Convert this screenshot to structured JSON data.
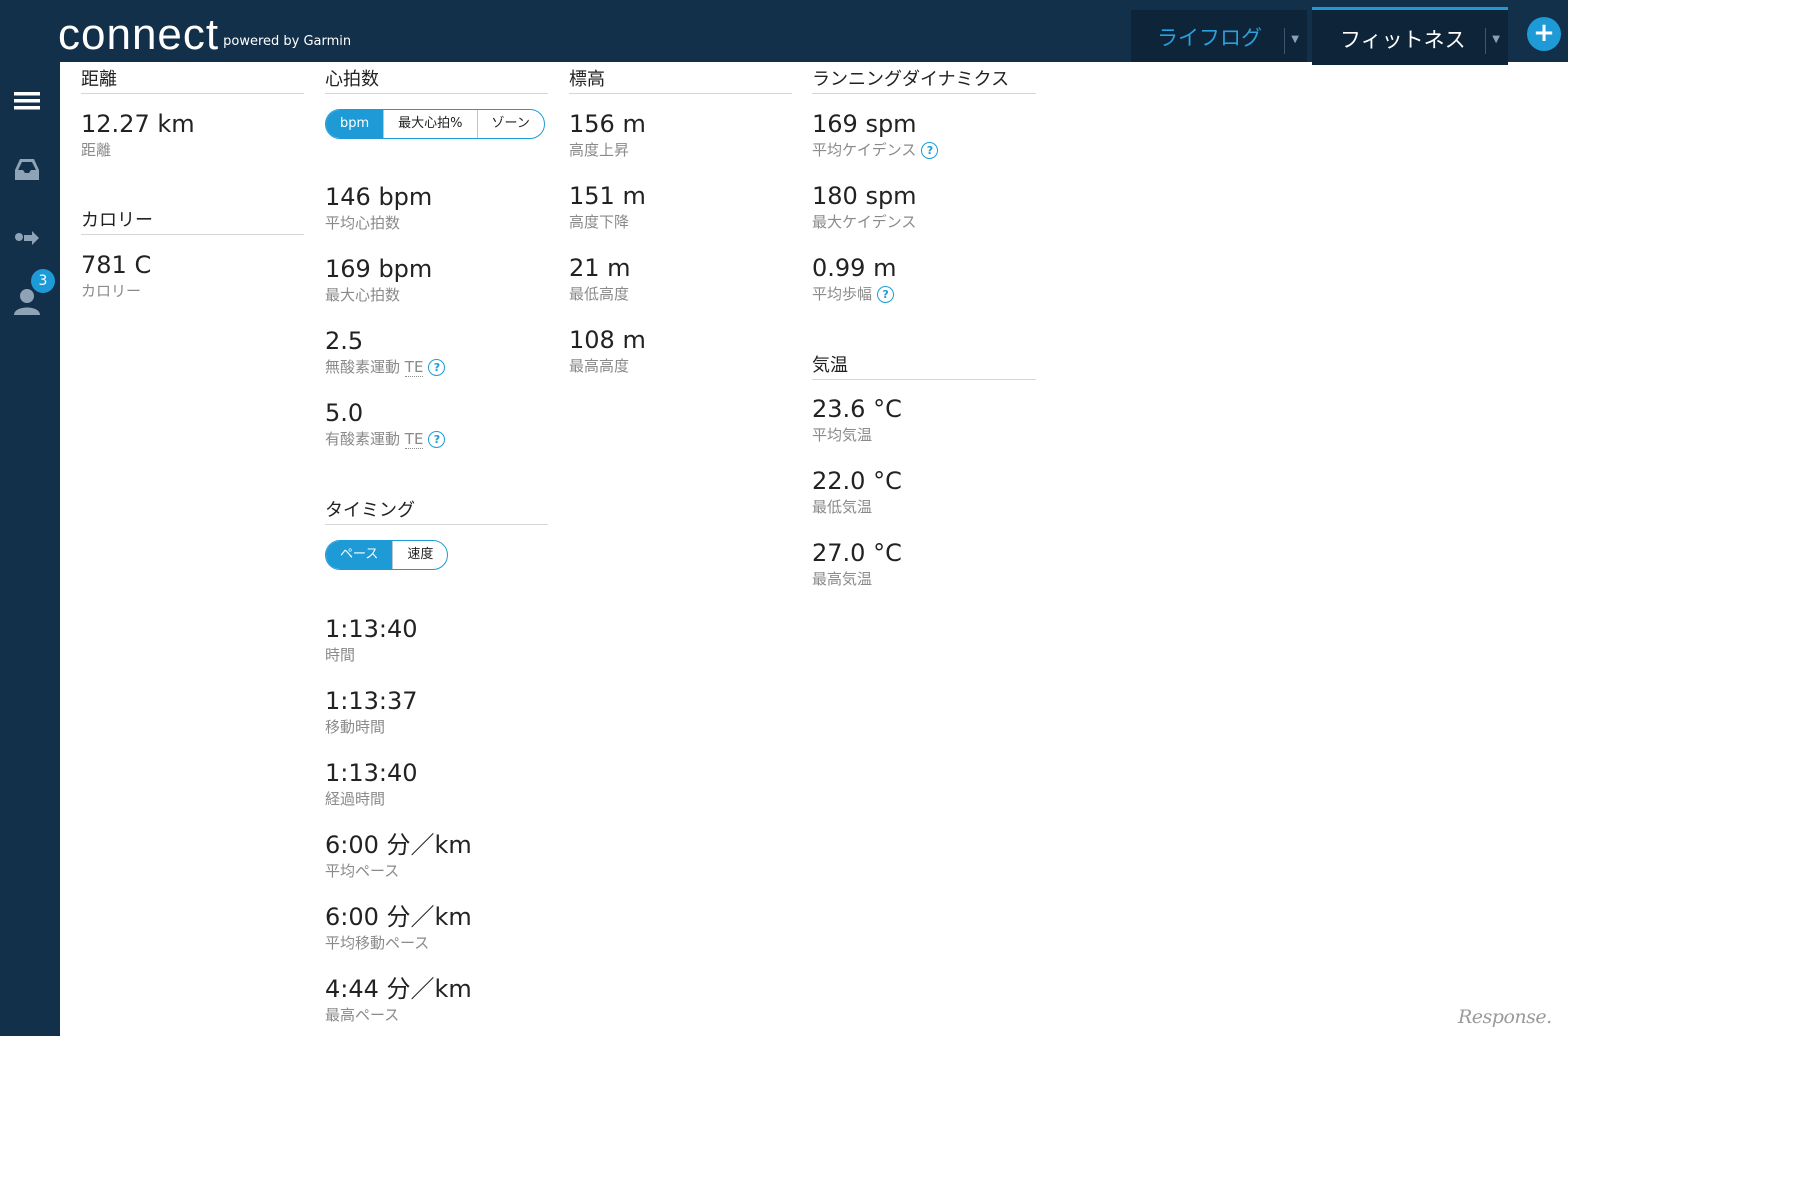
{
  "header": {
    "logo_text": "connect",
    "logo_sub": "powered by Garmin",
    "tabs": [
      {
        "label": "ライフログ",
        "active": false
      },
      {
        "label": "フィットネス",
        "active": true
      }
    ],
    "plus_label": "+"
  },
  "sidebar": {
    "items": [
      {
        "icon": "menu-icon"
      },
      {
        "icon": "inbox-icon"
      },
      {
        "icon": "connections-icon",
        "badge": "3"
      },
      {
        "icon": "profile-icon"
      }
    ]
  },
  "distance": {
    "title": "距離",
    "metrics": [
      {
        "value": "12.27 km",
        "label": "距離"
      }
    ]
  },
  "calories": {
    "title": "カロリー",
    "metrics": [
      {
        "value": "781 C",
        "label": "カロリー"
      }
    ]
  },
  "heart_rate": {
    "title": "心拍数",
    "toggle": [
      "bpm",
      "最大心拍%",
      "ゾーン"
    ],
    "toggle_active": "bpm",
    "metrics": [
      {
        "value": "146 bpm",
        "label": "平均心拍数"
      },
      {
        "value": "169 bpm",
        "label": "最大心拍数"
      },
      {
        "value": "2.5",
        "label": "無酸素運動",
        "suffix": "TE"
      },
      {
        "value": "5.0",
        "label": "有酸素運動",
        "suffix": "TE"
      }
    ]
  },
  "timing": {
    "title": "タイミング",
    "toggle": [
      "ペース",
      "速度"
    ],
    "toggle_active": "ペース",
    "metrics": [
      {
        "value": "1:13:40",
        "label": "時間"
      },
      {
        "value": "1:13:37",
        "label": "移動時間"
      },
      {
        "value": "1:13:40",
        "label": "経過時間"
      },
      {
        "value": "6:00 分／km",
        "label": "平均ペース"
      },
      {
        "value": "6:00 分／km",
        "label": "平均移動ペース"
      },
      {
        "value": "4:44 分／km",
        "label": "最高ペース"
      }
    ]
  },
  "elevation": {
    "title": "標高",
    "metrics": [
      {
        "value": "156 m",
        "label": "高度上昇"
      },
      {
        "value": "151 m",
        "label": "高度下降"
      },
      {
        "value": "21 m",
        "label": "最低高度"
      },
      {
        "value": "108 m",
        "label": "最高高度"
      }
    ]
  },
  "running_dynamics": {
    "title": "ランニングダイナミクス",
    "metrics": [
      {
        "value": "169 spm",
        "label": "平均ケイデンス"
      },
      {
        "value": "180 spm",
        "label": "最大ケイデンス"
      },
      {
        "value": "0.99 m",
        "label": "平均歩幅"
      }
    ]
  },
  "temperature": {
    "title": "気温",
    "metrics": [
      {
        "value": "23.6 °C",
        "label": "平均気温"
      },
      {
        "value": "22.0 °C",
        "label": "最低気温"
      },
      {
        "value": "27.0 °C",
        "label": "最高気温"
      }
    ]
  },
  "help_glyph": "?",
  "watermark": "Response."
}
